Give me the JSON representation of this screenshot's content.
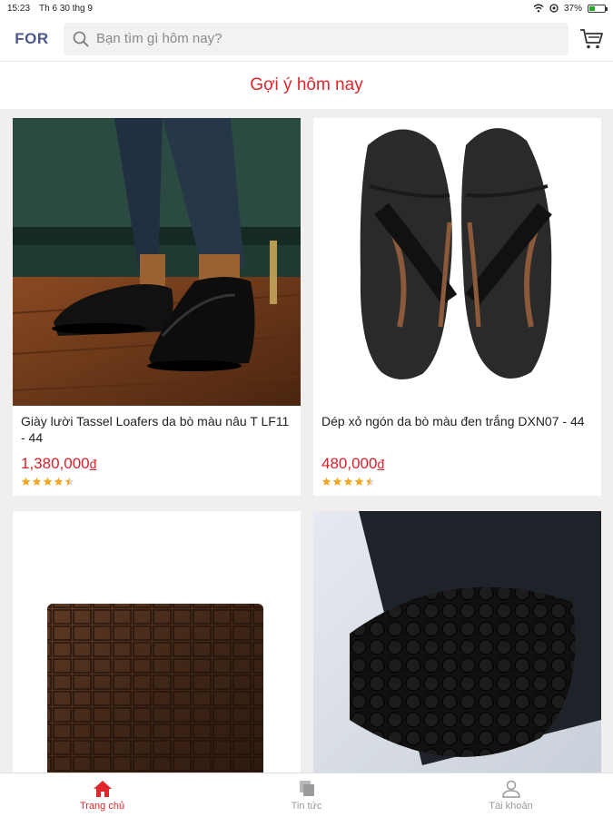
{
  "status_bar": {
    "time": "15:23",
    "date": "Th 6 30 thg 9",
    "battery": "37%",
    "battery_level": 0.37
  },
  "header": {
    "logo": "FOR",
    "search_placeholder": "Bạn tìm gì hôm nay?",
    "icons": {
      "search": "search-icon",
      "cart": "cart-icon"
    }
  },
  "section": {
    "title": "Gợi ý hôm nay"
  },
  "products": [
    {
      "name": "Giày lười Tassel Loafers da bò màu nâu T LF11 - 44",
      "price": "1,380,000",
      "currency": "đ",
      "rating": 4.5,
      "image": "black-leather-shoes-photo"
    },
    {
      "name": "Dép xỏ ngón da bò màu đen trắng DXN07 - 44",
      "price": "480,000",
      "currency": "đ",
      "rating": 4.5,
      "image": "black-flip-flops-photo"
    },
    {
      "name": "",
      "price": "",
      "image": "brown-croc-wallet-photo"
    },
    {
      "name": "",
      "price": "",
      "image": "black-croc-wallet-photo"
    }
  ],
  "bottom_nav": [
    {
      "label": "Trang chủ",
      "icon": "home-icon",
      "active": true
    },
    {
      "label": "Tin tức",
      "icon": "news-icon",
      "active": false
    },
    {
      "label": "Tài khoản",
      "icon": "user-icon",
      "active": false
    }
  ],
  "colors": {
    "accent": "#e0262b",
    "price": "#d8202a",
    "star": "#f5a623",
    "logo": "#4b5a8a"
  }
}
